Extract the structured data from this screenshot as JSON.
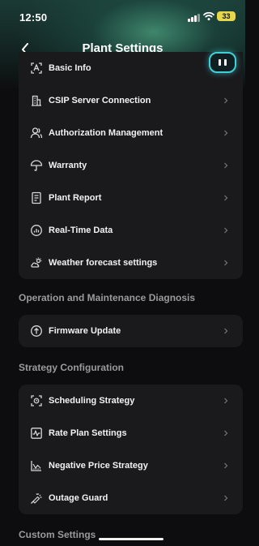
{
  "status_bar": {
    "time": "12:50",
    "battery": "33"
  },
  "nav": {
    "title": "Plant Settings"
  },
  "general_items": [
    {
      "label": "Basic Info",
      "icon": "basic-info-icon"
    },
    {
      "label": "CSIP Server Connection",
      "icon": "server-building-icon"
    },
    {
      "label": "Authorization Management",
      "icon": "users-icon"
    },
    {
      "label": "Warranty",
      "icon": "umbrella-icon"
    },
    {
      "label": "Plant Report",
      "icon": "report-icon"
    },
    {
      "label": "Real-Time Data",
      "icon": "gauge-icon"
    },
    {
      "label": "Weather forecast settings",
      "icon": "weather-icon"
    }
  ],
  "sections": {
    "om_title": "Operation and Maintenance Diagnosis",
    "strategy_title": "Strategy Configuration",
    "custom_title": "Custom Settings"
  },
  "om_items": [
    {
      "label": "Firmware Update",
      "icon": "firmware-update-icon"
    }
  ],
  "strategy_items": [
    {
      "label": "Scheduling Strategy",
      "icon": "scheduling-icon"
    },
    {
      "label": "Rate Plan Settings",
      "icon": "rate-plan-icon"
    },
    {
      "label": "Negative Price Strategy",
      "icon": "negative-price-icon"
    },
    {
      "label": "Outage Guard",
      "icon": "outage-guard-icon"
    }
  ]
}
